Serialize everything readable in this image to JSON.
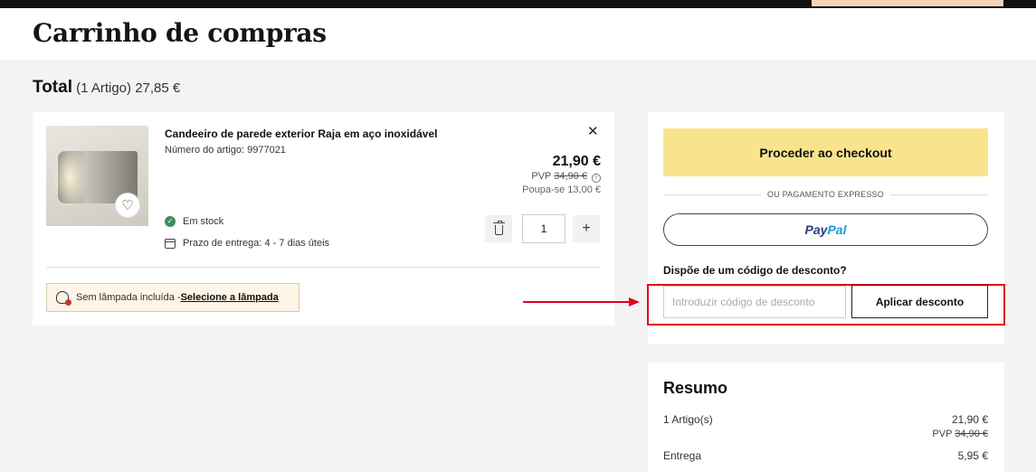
{
  "header": {
    "page_title": "Carrinho de compras"
  },
  "total": {
    "label": "Total",
    "count": "(1 Artigo)",
    "amount": "27,85 €"
  },
  "cart_item": {
    "name": "Candeeiro de parede exterior Raja em aço inoxidável",
    "article_number": "Número do artigo: 9977021",
    "price": "21,90 €",
    "pvp_label": "PVP",
    "pvp_price": "34,90 €",
    "savings": "Poupa-se 13,00 €",
    "stock": "Em stock",
    "delivery": "Prazo de entrega: 4 - 7 dias úteis",
    "quantity": "1",
    "bulb_notice": "Sem lâmpada incluída - ",
    "bulb_link": "Selecione a lâmpada"
  },
  "checkout": {
    "checkout_button": "Proceder ao checkout",
    "express_label": "OU PAGAMENTO EXPRESSO",
    "paypal_a": "Pay",
    "paypal_b": "Pal",
    "discount_heading": "Dispõe de um código de desconto?",
    "discount_placeholder": "Introduzir código de desconto",
    "apply_button": "Aplicar desconto"
  },
  "summary": {
    "title": "Resumo",
    "items_label": "1 Artigo(s)",
    "items_value": "21,90 €",
    "pvp_label": "PVP",
    "pvp_value": "34,90 €",
    "delivery_label": "Entrega",
    "delivery_value": "5,95 €"
  },
  "colors": {
    "checkout_button": "#f9e48d",
    "highlight_box": "#e3001b",
    "in_stock": "#3e8f5f"
  },
  "icons": [
    "close-icon",
    "heart-icon",
    "check-icon",
    "calendar-icon",
    "trash-icon",
    "plus-icon",
    "info-icon",
    "bulb-icon"
  ]
}
